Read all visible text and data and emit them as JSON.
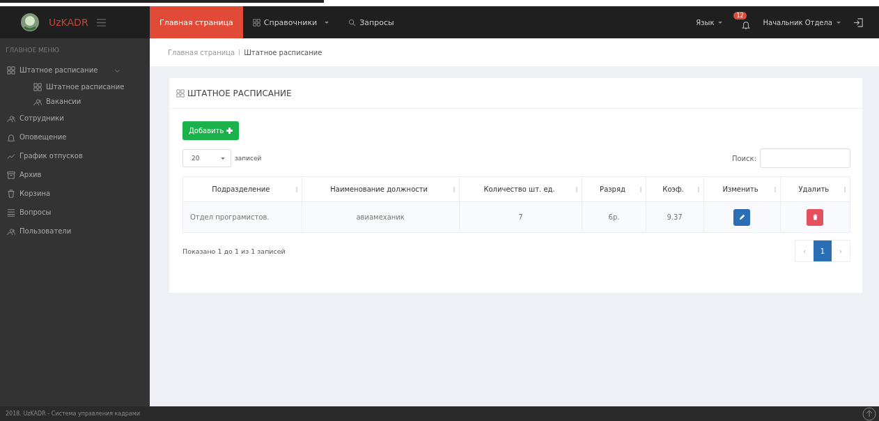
{
  "brand": {
    "title": "UzKADR"
  },
  "nav": [
    {
      "label": "Главная страница",
      "selected": true,
      "kind": "plain"
    },
    {
      "label": "Справочники",
      "selected": false,
      "kind": "dropdown"
    },
    {
      "label": "Запросы",
      "selected": false,
      "kind": "search"
    }
  ],
  "user_bar": {
    "language": "Язык",
    "notifications": "12",
    "user": "Начальник Отдела"
  },
  "sidebar": {
    "heading": "ГЛАВНОЕ МЕНЮ",
    "items": [
      {
        "label": "Штатное расписание",
        "expanded": true,
        "children": [
          {
            "label": "Штатное расписание"
          },
          {
            "label": "Вакансии"
          }
        ]
      },
      {
        "label": "Сотрудники"
      },
      {
        "label": "Оповещение"
      },
      {
        "label": "График отпусков"
      },
      {
        "label": "Архив"
      },
      {
        "label": "Корзина"
      },
      {
        "label": "Вопросы"
      },
      {
        "label": "Пользователи"
      }
    ]
  },
  "breadcrumb": [
    "Главная страница",
    "Штатное расписание"
  ],
  "card": {
    "title": "ШТАТНОЕ РАСПИСАНИЕ",
    "add_button": "Добавить",
    "page_size": "20",
    "page_size_label": "записей",
    "search_label": "Поиск:",
    "table": {
      "columns": [
        "Подразделение",
        "Наименование должности",
        "Количество шт. ед.",
        "Разряд",
        "Коэф.",
        "Изменить",
        "Удалить"
      ],
      "rows": [
        {
          "cells": [
            "Отдел програмистов.",
            "авиамеханик",
            "7",
            "6р.",
            "9.37"
          ]
        }
      ]
    },
    "info": "Показано 1 до 1 из 1 записей",
    "pagination": [
      {
        "label": "‹",
        "selected": false
      },
      {
        "label": "1",
        "selected": true
      },
      {
        "label": "›",
        "selected": false
      }
    ]
  },
  "footer": {
    "text": "2018. UzKADR - Система управления кадрами"
  }
}
